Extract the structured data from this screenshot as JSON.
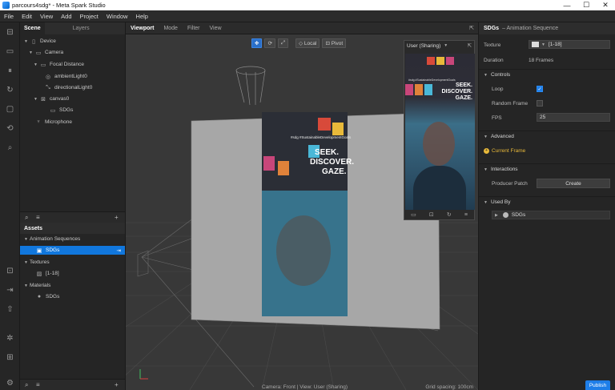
{
  "window": {
    "title": "parcours4sdg* - Meta Spark Studio",
    "minimize": "—",
    "maximize": "☐",
    "close": "✕"
  },
  "menu": [
    "File",
    "Edit",
    "View",
    "Add",
    "Project",
    "Window",
    "Help"
  ],
  "scene": {
    "tab_active": "Scene",
    "tab_inactive": "Layers",
    "tree": [
      {
        "label": "Device",
        "icon": "device-icon",
        "level": 0,
        "caret": "▼"
      },
      {
        "label": "Camera",
        "icon": "camera-icon",
        "level": 1,
        "caret": "▼"
      },
      {
        "label": "Focal Distance",
        "icon": "focal-distance-icon",
        "level": 2,
        "caret": "▼"
      },
      {
        "label": "ambientLight0",
        "icon": "ambient-light-icon",
        "level": 3,
        "caret": ""
      },
      {
        "label": "directionalLight0",
        "icon": "directional-light-icon",
        "level": 3,
        "caret": ""
      },
      {
        "label": "canvas0",
        "icon": "canvas-icon",
        "level": 2,
        "caret": "▼"
      },
      {
        "label": "SDGs",
        "icon": "rectangle-icon",
        "level": 3,
        "caret": ""
      },
      {
        "label": "Microphone",
        "icon": "microphone-icon",
        "level": 1,
        "caret": ""
      }
    ]
  },
  "assets": {
    "header": "Assets",
    "items": [
      {
        "label": "Animation Sequences",
        "type": "group",
        "caret": "▼"
      },
      {
        "label": "SDGs",
        "type": "item",
        "selected": true,
        "icon": "animation-sequence-icon"
      },
      {
        "label": "Textures",
        "type": "group",
        "caret": "▼"
      },
      {
        "label": "[1-18]",
        "type": "item",
        "icon": "texture-icon"
      },
      {
        "label": "Materials",
        "type": "group",
        "caret": "▼"
      },
      {
        "label": "SDGs",
        "type": "item",
        "icon": "material-icon"
      }
    ]
  },
  "viewport": {
    "tabs": [
      "Viewport",
      "Mode",
      "Filter",
      "View"
    ],
    "tools": {
      "local": "Local",
      "pivot": "Pivot"
    },
    "preview_label": "User (Sharing)",
    "preview_hashtag": "#sdg #SustainableDevelopmentGoals",
    "preview_slogan": [
      "SEEK.",
      "DISCOVER.",
      "GAZE."
    ],
    "status_camera": "Camera: Front | View: User (Sharing)",
    "status_grid": "Grid spacing: 100cm"
  },
  "props": {
    "name": "SDGs",
    "type": "– Animation Sequence",
    "texture_label": "Texture",
    "texture_value": "[1-18]",
    "duration_label": "Duration",
    "duration_value": "18 Frames",
    "controls_label": "Controls",
    "loop_label": "Loop",
    "random_label": "Random Frame",
    "fps_label": "FPS",
    "fps_value": "25",
    "advanced_label": "Advanced",
    "current_frame_label": "Current Frame",
    "interactions_label": "Interactions",
    "producer_patch_label": "Producer Patch",
    "create_label": "Create",
    "used_by_label": "Used By",
    "used_by_item": "SDGs",
    "publish_label": "Publish"
  },
  "colors": {
    "accent": "#1e7ee8",
    "selection": "#1177dd",
    "current_frame": "#e8b93a"
  }
}
